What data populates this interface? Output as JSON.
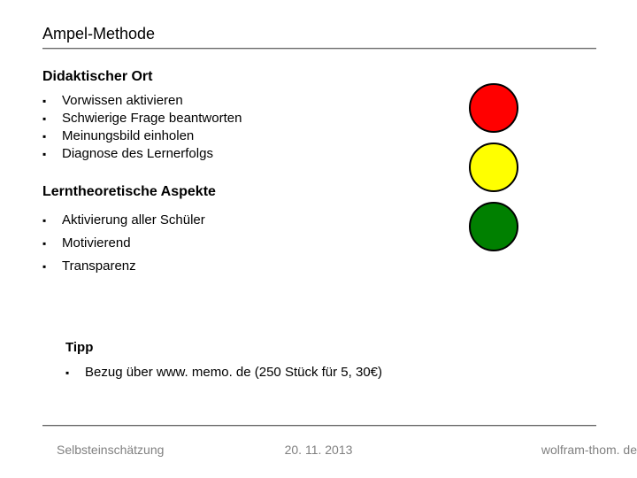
{
  "title": "Ampel-Methode",
  "section1": {
    "heading": "Didaktischer Ort",
    "items": [
      "Vorwissen aktivieren",
      "Schwierige Frage beantworten",
      "Meinungsbild einholen",
      "Diagnose des Lernerfolgs"
    ]
  },
  "section2": {
    "heading": "Lerntheoretische Aspekte",
    "items": [
      "Aktivierung aller Schüler",
      "Motivierend",
      "Transparenz"
    ]
  },
  "tipp": {
    "heading": "Tipp",
    "items": [
      "Bezug über www. memo. de  (250 Stück für 5, 30€)"
    ]
  },
  "traffic_light": {
    "circles": [
      {
        "color": "#ff0000"
      },
      {
        "color": "#ffff00"
      },
      {
        "color": "#008000"
      }
    ]
  },
  "footer": {
    "left": "Selbsteinschätzung",
    "center": "20. 11. 2013",
    "right": "wolfram-thom. de"
  }
}
